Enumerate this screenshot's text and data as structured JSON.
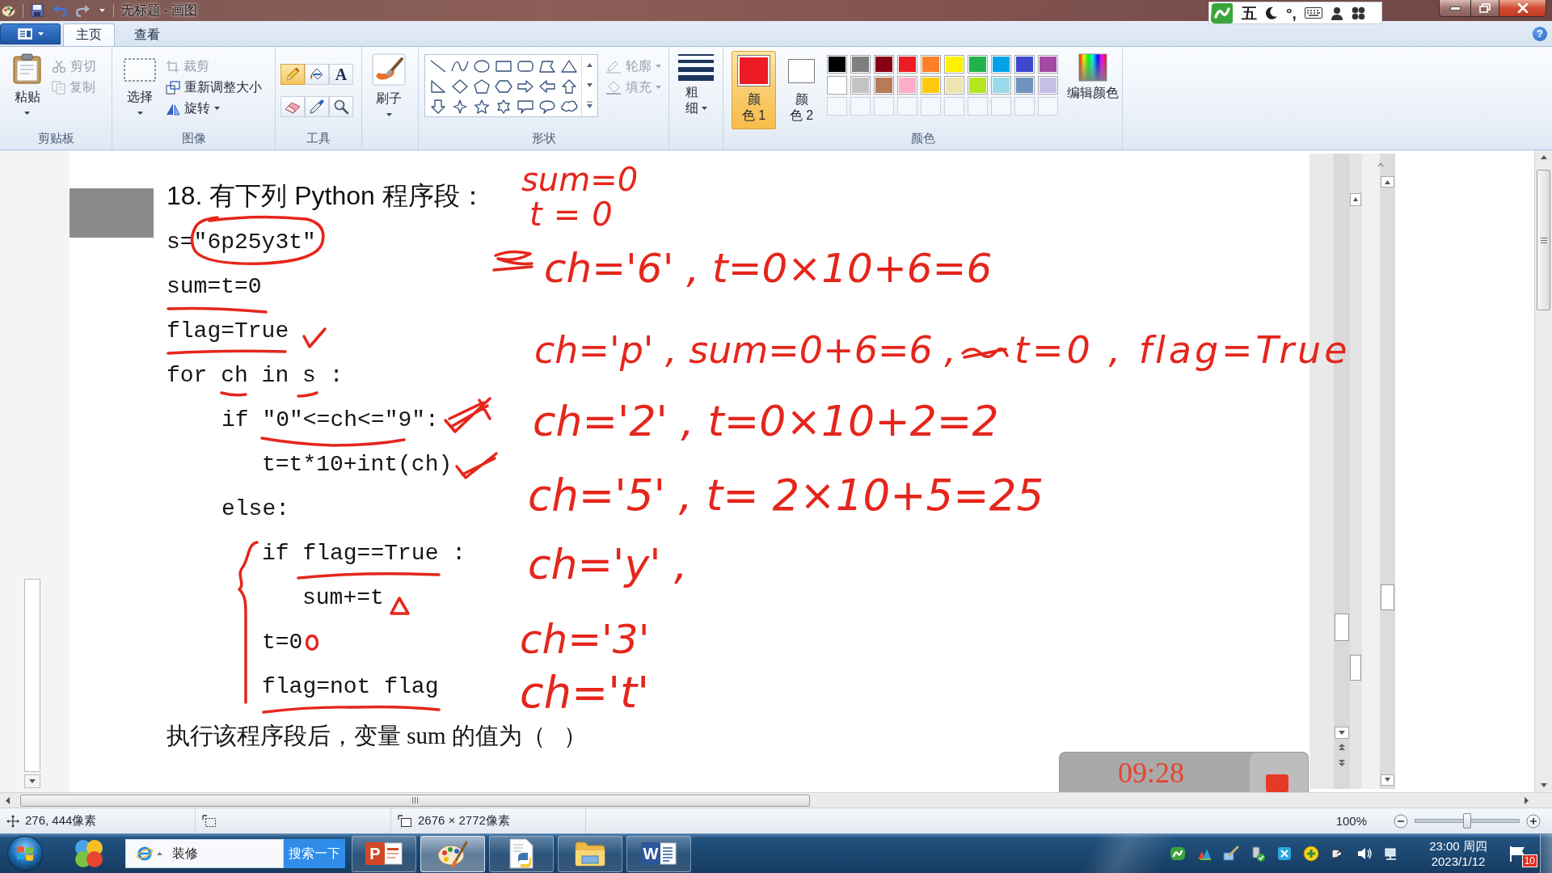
{
  "title_bar": {
    "title": "无标题 - 画图"
  },
  "ime_toolbar": {
    "mode": "五",
    "punctuation": "°,"
  },
  "ribbon": {
    "tabs": [
      {
        "label": "主页",
        "selected": true
      },
      {
        "label": "查看",
        "selected": false
      }
    ],
    "help": "?",
    "clipboard": {
      "label": "剪贴板",
      "paste": "粘贴",
      "actions": [
        {
          "label": "剪切",
          "disabled": true
        },
        {
          "label": "复制",
          "disabled": true
        }
      ]
    },
    "image": {
      "label": "图像",
      "select": "选择",
      "actions": [
        {
          "label": "裁剪",
          "disabled": true
        },
        {
          "label": "重新调整大小",
          "disabled": false
        },
        {
          "label": "旋转",
          "disabled": false
        }
      ]
    },
    "tools": {
      "label": "工具",
      "items": [
        {
          "selected": true
        },
        {
          "selected": false
        },
        {
          "glyph": "A",
          "selected": false
        },
        {
          "selected": false
        },
        {
          "selected": false
        },
        {
          "selected": false
        }
      ]
    },
    "brushes": {
      "label": "刷子"
    },
    "shapes": {
      "label": "形状",
      "outline": {
        "label": "轮廓",
        "disabled": true
      },
      "fill": {
        "label": "填充",
        "disabled": true
      }
    },
    "size": {
      "label": "粗细"
    },
    "colors": {
      "label": "颜色",
      "color_1": {
        "label": "颜色 1",
        "color": "#ed1c24",
        "selected": true
      },
      "color_2": {
        "label": "颜色 2",
        "color": "#ffffff",
        "selected": false
      },
      "palette": [
        {
          "color": "#000000"
        },
        {
          "color": "#7f7f7f"
        },
        {
          "color": "#880015"
        },
        {
          "color": "#ed1c24"
        },
        {
          "color": "#ff7f27"
        },
        {
          "color": "#fff200"
        },
        {
          "color": "#22b14c"
        },
        {
          "color": "#00a2e8"
        },
        {
          "color": "#3f48cc"
        },
        {
          "color": "#a349a4"
        },
        {
          "color": "#ffffff"
        },
        {
          "color": "#c3c3c3"
        },
        {
          "color": "#b97a57"
        },
        {
          "color": "#ffaec9"
        },
        {
          "color": "#ffc90e"
        },
        {
          "color": "#efe4b0"
        },
        {
          "color": "#b5e61d"
        },
        {
          "color": "#99d9ea"
        },
        {
          "color": "#7092be"
        },
        {
          "color": "#c8bfe7"
        }
      ],
      "edit": "编辑颜色"
    }
  },
  "canvas": {
    "question": {
      "title": "18. 有下列 Python 程序段：",
      "code": [
        {
          "text": "s=\"6p25y3t\""
        },
        {
          "text": "sum=t=0"
        },
        {
          "text": "flag=True"
        },
        {
          "text": "for ch in s :",
          "children": [
            {
              "text": "if \"0\"<=ch<=\"9\":",
              "children": [
                {
                  "text": "t=t*10+int(ch)"
                }
              ]
            },
            {
              "text": "else:",
              "children": [
                {
                  "text": "if flag==True :",
                  "children": [
                    {
                      "text": "sum+=t"
                    }
                  ]
                },
                {
                  "text": "t=0"
                },
                {
                  "text": "flag=not flag"
                }
              ]
            }
          ]
        }
      ],
      "prompt": "执行该程序段后，变量 sum 的值为（   ）"
    },
    "handwriting": [
      "sum=0",
      "t=0",
      "ch='6' , t=0×10+6=6",
      "ch='p' , sum=0+6=6 ,",
      "t=0 , flag=True",
      "ch='2' , t=0×10+2=2",
      "ch='5' , t= 2×10+5=25",
      "ch='y' ,",
      "ch='3'",
      "ch='t'"
    ]
  },
  "recording_timer": {
    "time": "09:28"
  },
  "status_bar": {
    "cursor_position": "276, 444像素",
    "image_size": "2676 × 2772像素",
    "zoom": {
      "label": "100%",
      "level": 0.5
    }
  },
  "taskbar": {
    "search": {
      "value": "装修",
      "button": "搜索一下"
    },
    "apps": [
      {
        "glyph": "P",
        "selected": false
      },
      {
        "selected": true
      },
      {
        "selected": false
      },
      {
        "selected": false
      },
      {
        "glyph": "W",
        "selected": false
      }
    ],
    "clock": {
      "time": "23:00 周四",
      "date": "2023/1/12"
    },
    "notifications": {
      "count": "10"
    }
  }
}
